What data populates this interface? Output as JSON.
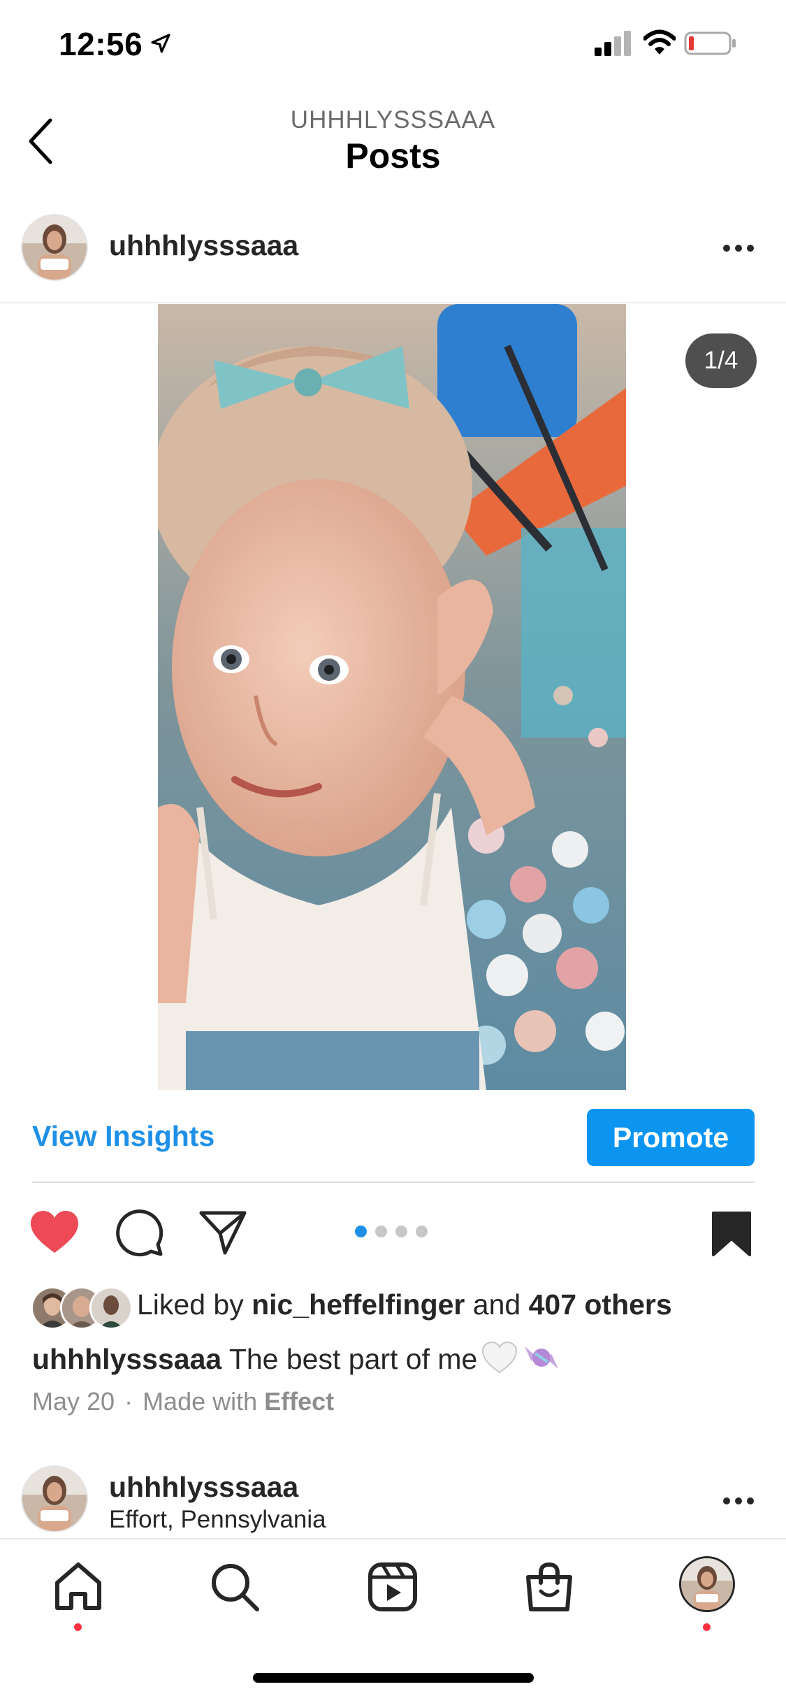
{
  "status_bar": {
    "time": "12:56",
    "icons": [
      "location-arrow-icon",
      "cellular-signal-icon",
      "wifi-icon",
      "battery-low-icon"
    ]
  },
  "header": {
    "username": "UHHHLYSSSAAA",
    "title": "Posts",
    "back_icon": "chevron-left-icon"
  },
  "post": {
    "username": "uhhhlysssaaa",
    "more_icon": "more-horizontal-icon",
    "image_counter": "1/4",
    "carousel": {
      "total": 4,
      "active_index": 0
    },
    "view_insights_label": "View Insights",
    "promote_label": "Promote",
    "actions": {
      "like_icon": "heart-filled-icon",
      "liked": true,
      "comment_icon": "comment-icon",
      "share_icon": "paper-plane-icon",
      "save_icon": "bookmark-filled-icon"
    },
    "likes": {
      "prefix": "Liked by ",
      "user": "nic_heffelfinger",
      "middle": " and ",
      "others": "407 others"
    },
    "caption": {
      "username": "uhhhlysssaaa",
      "text": " The best part of me"
    },
    "meta": {
      "date": "May 20",
      "separator": "·",
      "made_with_prefix": "Made with ",
      "effect": "Effect"
    }
  },
  "next_post": {
    "username": "uhhhlysssaaa",
    "location": "Effort, Pennsylvania",
    "more_icon": "more-horizontal-icon"
  },
  "tab_bar": {
    "items": [
      "home-icon",
      "search-icon",
      "reels-icon",
      "shop-icon",
      "profile-avatar"
    ]
  },
  "colors": {
    "accent_blue": "#0b95f0",
    "link_blue": "#1e90e8",
    "like_red": "#ed4956",
    "notif_red": "#ff3040",
    "muted_text": "#8e8e8e"
  }
}
